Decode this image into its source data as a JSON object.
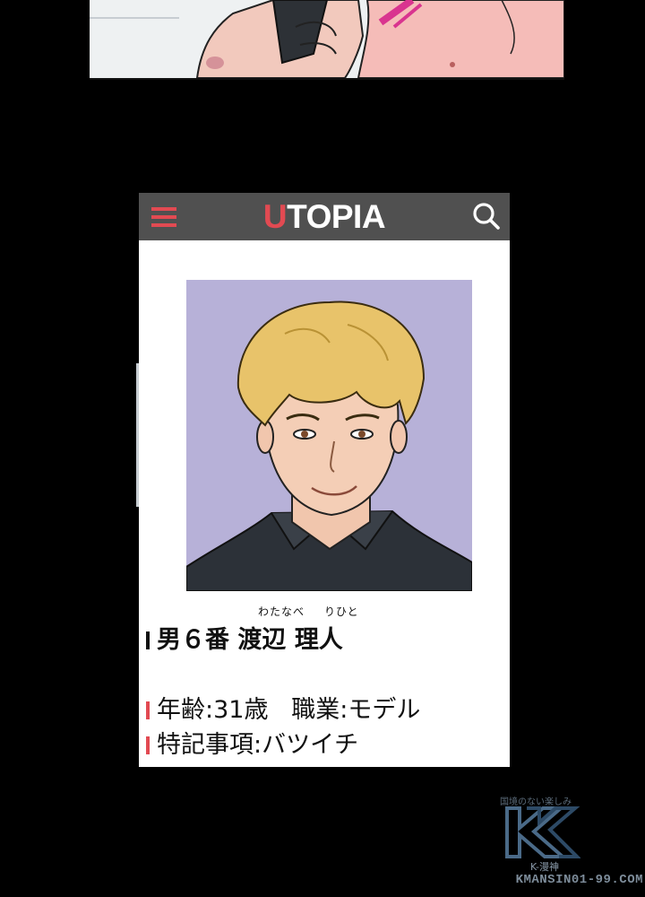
{
  "app": {
    "title_first": "U",
    "title_rest": "TOPIA",
    "accent_color": "#e24a52",
    "bar_color": "#505050",
    "menu_icon": "hamburger-menu-icon",
    "search_icon": "search-icon"
  },
  "profile": {
    "number_label": "男６番",
    "surname": "渡辺",
    "given_name": "理人",
    "surname_reading": "わたなべ",
    "given_name_reading": "りひと",
    "age_label": "年齢:",
    "age_value": "31歳",
    "job_label": "職業:",
    "job_value": "モデル",
    "notes_label": "特記事項:",
    "notes_value": "バツイチ"
  },
  "watermark": {
    "tagline": "国境のない楽しみ",
    "brand": "K-漫神",
    "url": "KMANSIN01-99.COM"
  }
}
